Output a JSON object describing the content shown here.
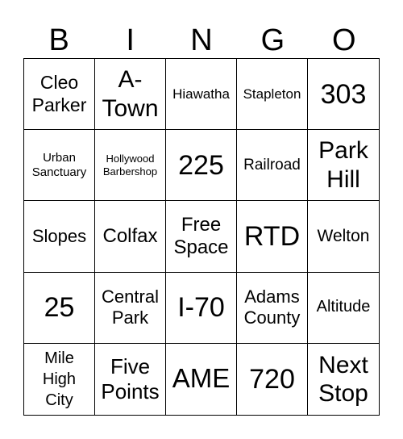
{
  "header": [
    "B",
    "I",
    "N",
    "G",
    "O"
  ],
  "cells": [
    "Cleo Parker",
    "A-Town",
    "Hiawatha",
    "Stapleton",
    "303",
    "Urban Sanctuary",
    "Hollywood Barbershop",
    "225",
    "Railroad",
    "Park Hill",
    "Slopes",
    "Colfax",
    "Free Space",
    "RTD",
    "Welton",
    "25",
    "Central Park",
    "I-70",
    "Adams County",
    "Altitude",
    "Mile High City",
    "Five Points",
    "AME",
    "720",
    "Next Stop"
  ]
}
